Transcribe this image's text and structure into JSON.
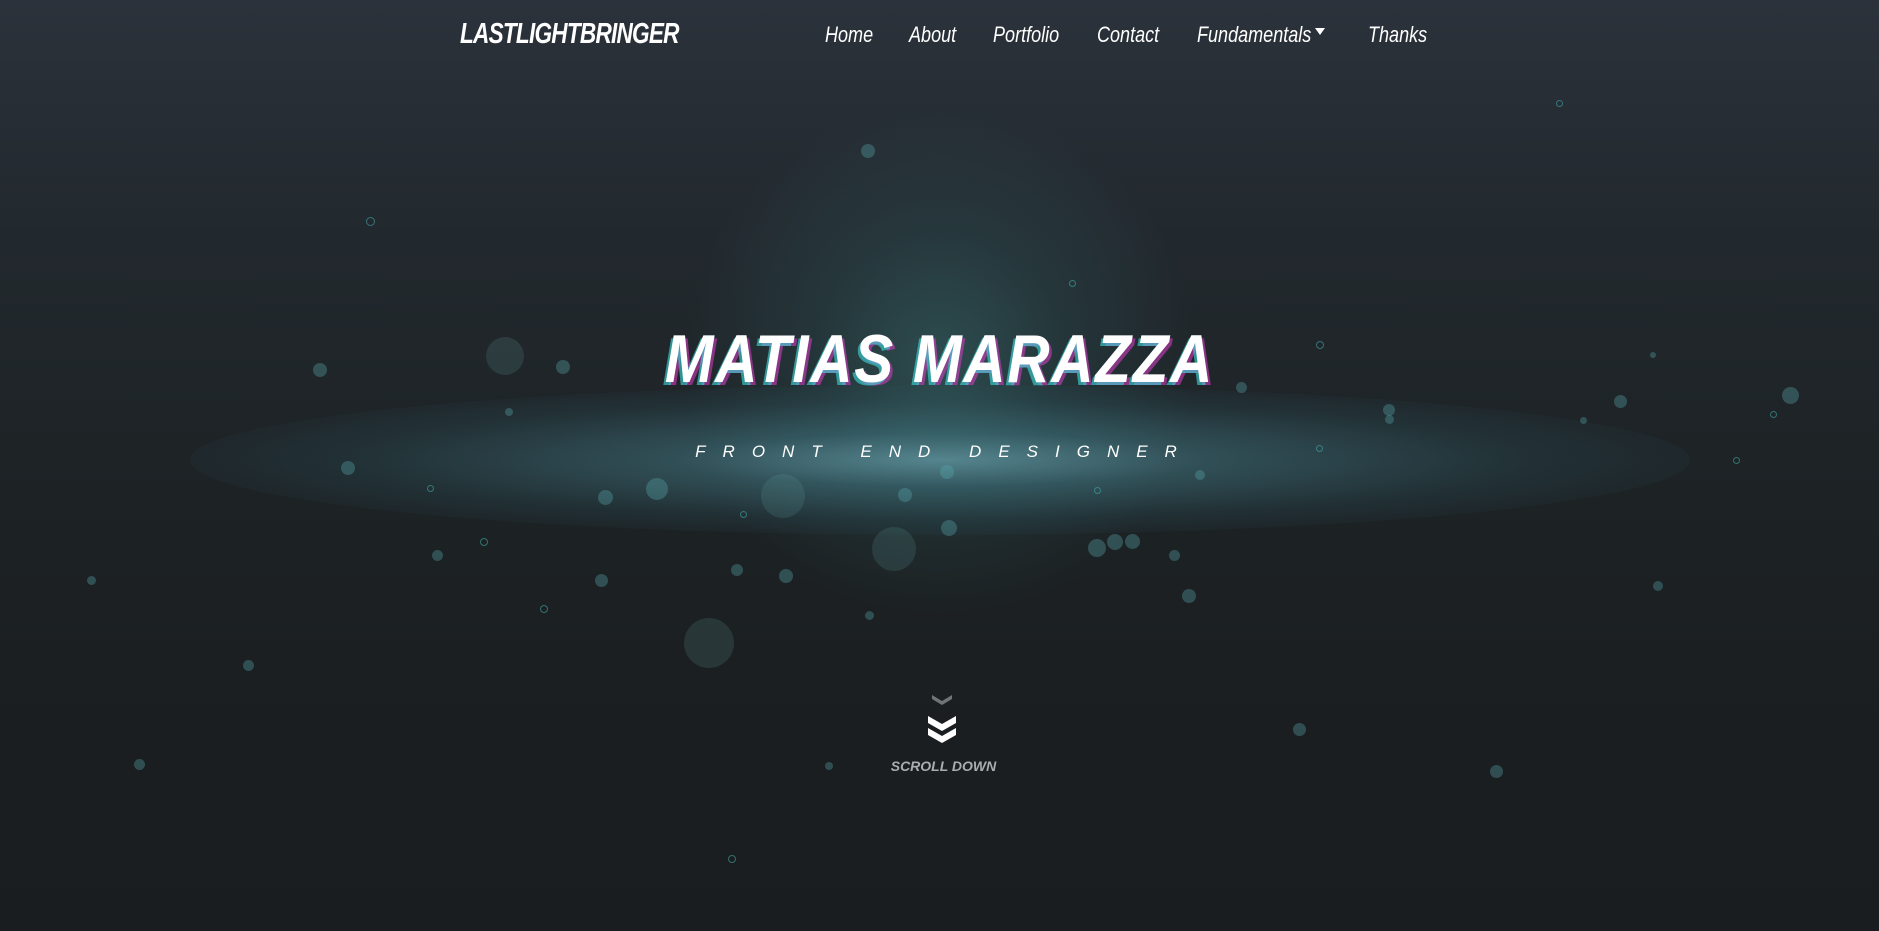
{
  "header": {
    "brand": "LASTLIGHTBRINGER",
    "nav": [
      {
        "label": "Home"
      },
      {
        "label": "About"
      },
      {
        "label": "Portfolio"
      },
      {
        "label": "Contact"
      },
      {
        "label": "Fundamentals",
        "has_dropdown": true
      },
      {
        "label": "Thanks"
      }
    ]
  },
  "hero": {
    "name": "MATIAS MARAZZA",
    "subtitle": "FRONT END DESIGNER"
  },
  "scroll": {
    "label": "SCROLL DOWN",
    "icon": "double-chevron-down-icon"
  },
  "colors": {
    "background_top": "#2b323b",
    "background_bottom": "#1a1d1f",
    "glow": "#7dc3d2",
    "text": "#ffffff",
    "scroll_label": "#a9adb1"
  }
}
